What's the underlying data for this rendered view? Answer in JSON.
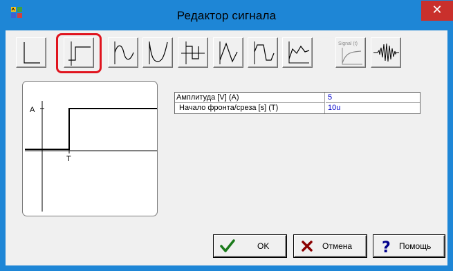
{
  "window": {
    "title": "Редактор сигнала",
    "close_glyph": "✕",
    "app_icon": "signal-editor-icon"
  },
  "toolbar": {
    "buttons": [
      {
        "id": "impulse",
        "icon": "impulse-icon",
        "selected": false
      },
      {
        "id": "step",
        "icon": "step-icon",
        "selected": true
      },
      {
        "id": "sine",
        "icon": "sine-icon",
        "selected": false
      },
      {
        "id": "abs-sine",
        "icon": "abs-sine-icon",
        "selected": false
      },
      {
        "id": "square",
        "icon": "square-wave-icon",
        "selected": false
      },
      {
        "id": "triangle",
        "icon": "triangle-wave-icon",
        "selected": false
      },
      {
        "id": "trapezoid",
        "icon": "trapezoid-wave-icon",
        "selected": false
      },
      {
        "id": "piecewise",
        "icon": "piecewise-linear-icon",
        "selected": false
      },
      {
        "id": "custom",
        "icon": "signal-t-icon",
        "label": "Signal (t)",
        "selected": false
      },
      {
        "id": "burst",
        "icon": "burst-icon",
        "selected": false
      }
    ]
  },
  "preview": {
    "amplitude_label": "A",
    "time_label": "T"
  },
  "parameters": [
    {
      "label": "Амплитуда [V] (A)",
      "value": "5"
    },
    {
      "label": "Начало фронта/среза [s] (T)",
      "value": "10u"
    }
  ],
  "buttons": {
    "ok": "OK",
    "cancel": "Отмена",
    "help": "Помощь"
  },
  "colors": {
    "titlebar": "#1e86d6",
    "selection_ring": "#e0141e",
    "value_text": "#0000c8",
    "ok_check": "#1a7a1a",
    "cancel_x": "#8b0000",
    "help_q": "#00008b"
  }
}
